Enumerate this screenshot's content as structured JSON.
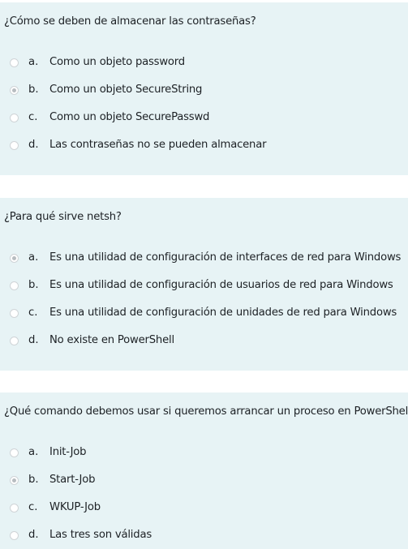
{
  "questions": [
    {
      "text": "¿Cómo se deben de almacenar las contraseñas?",
      "answers": [
        {
          "letter": "a.",
          "text": "Como un objeto password",
          "checked": false
        },
        {
          "letter": "b.",
          "text": "Como un objeto SecureString",
          "checked": true
        },
        {
          "letter": "c.",
          "text": "Como un objeto SecurePasswd",
          "checked": false
        },
        {
          "letter": "d.",
          "text": "Las contraseñas no se pueden almacenar",
          "checked": false
        }
      ]
    },
    {
      "text": "¿Para qué sirve netsh?",
      "answers": [
        {
          "letter": "a.",
          "text": "Es una utilidad de configuración de interfaces de red para Windows",
          "checked": true
        },
        {
          "letter": "b.",
          "text": "Es una utilidad de configuración de usuarios de red para Windows",
          "checked": false
        },
        {
          "letter": "c.",
          "text": "Es una utilidad de configuración de unidades de red para Windows",
          "checked": false
        },
        {
          "letter": "d.",
          "text": "No existe en PowerShell",
          "checked": false
        }
      ]
    },
    {
      "text": "¿Qué comando debemos usar si queremos arrancar un proceso en PowerShell?",
      "answers": [
        {
          "letter": "a.",
          "text": "Init-Job",
          "checked": false
        },
        {
          "letter": "b.",
          "text": "Start-Job",
          "checked": true
        },
        {
          "letter": "c.",
          "text": "WKUP-Job",
          "checked": false
        },
        {
          "letter": "d.",
          "text": "Las tres son válidas",
          "checked": false
        }
      ]
    }
  ],
  "colors": {
    "panel_background": "#e7f3f5",
    "text": "#1d2125",
    "radio_border": "#cfd4d7",
    "radio_selected_dot": "#b8bdc1"
  }
}
